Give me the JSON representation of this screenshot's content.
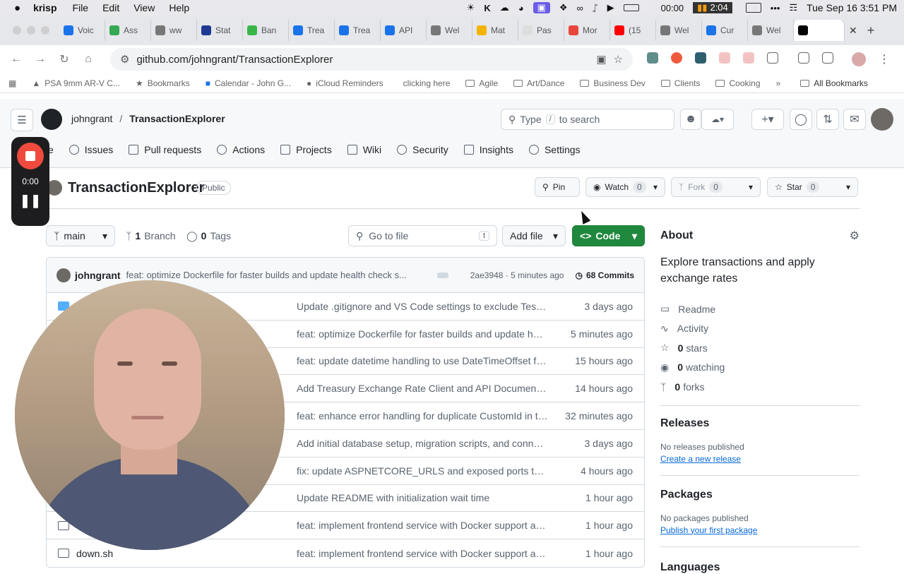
{
  "menubar": {
    "app": "krisp",
    "items": [
      "File",
      "Edit",
      "View",
      "Help"
    ],
    "timer": "00:00",
    "rec_badge": "2:04",
    "datetime": "Tue Sep 16  3:51 PM"
  },
  "tabs": [
    "Voic",
    "Ass",
    "ww",
    "Stat",
    "Ban",
    "Trea",
    "Trea",
    "API",
    "Wel",
    "Mat",
    "Pas",
    "Mor",
    "(15",
    "Wel",
    "Cur",
    "Wel",
    ""
  ],
  "tab_colors": [
    "#1a73e8",
    "#34a853",
    "#777777",
    "#1f3a93",
    "#3ab54a",
    "#1a73e8",
    "#1a73e8",
    "#1a73e8",
    "#777777",
    "#f4b400",
    "#dddddd",
    "#e8453c",
    "#ff0000",
    "#777777",
    "#1a73e8",
    "#777777",
    "#000000"
  ],
  "address": {
    "url": "github.com/johngrant/TransactionExplorer"
  },
  "bookmarks": [
    "PSA 9mm AR-V C...",
    "Bookmarks",
    "Calendar - John G...",
    "iCloud Reminders",
    "clicking here",
    "Agile",
    "Art/Dance",
    "Business Dev",
    "Clients",
    "Cooking",
    "All Bookmarks"
  ],
  "gh": {
    "owner": "johngrant",
    "sep": "/",
    "repo": "TransactionExplorer",
    "search_prefix": "Type",
    "search_key": "/",
    "search_suffix": "to search",
    "nav": [
      "e",
      "Issues",
      "Pull requests",
      "Actions",
      "Projects",
      "Wiki",
      "Security",
      "Insights",
      "Settings"
    ],
    "repo_title": "TransactionExplorer",
    "visibility": "Public",
    "pin": "Pin",
    "watch": "Watch",
    "watch_count": "0",
    "fork": "Fork",
    "fork_count": "0",
    "star": "Star",
    "star_count": "0",
    "branch": "main",
    "branches_num": "1",
    "branches_label": "Branch",
    "tags_num": "0",
    "tags_label": "Tags",
    "goto_placeholder": "Go to file",
    "goto_key": "t",
    "add_file": "Add file",
    "code": "Code"
  },
  "commit": {
    "author": "johngrant",
    "message": "feat: optimize Dockerfile for faster builds and update health check s...",
    "sha_time": "2ae3948 · 5 minutes ago",
    "count_label": "68 Commits"
  },
  "files": [
    {
      "name": "",
      "msg": "Update .gitignore and VS Code settings to exclude TestRe...",
      "time": "3 days ago"
    },
    {
      "name": "",
      "msg": "feat: optimize Dockerfile for faster builds and update heal...",
      "time": "5 minutes ago"
    },
    {
      "name": "",
      "msg": "feat: update datetime handling to use DateTimeOffset for ...",
      "time": "15 hours ago"
    },
    {
      "name": "",
      "msg": "Add Treasury Exchange Rate Client and API Documentation",
      "time": "14 hours ago"
    },
    {
      "name": "",
      "msg": "feat: enhance error handling for duplicate CustomId in tra...",
      "time": "32 minutes ago"
    },
    {
      "name": "",
      "msg": "Add initial database setup, migration scripts, and connect...",
      "time": "3 days ago"
    },
    {
      "name": "",
      "msg": "fix: update ASPNETCORE_URLS and exposed ports to us...",
      "time": "4 hours ago"
    },
    {
      "name": "",
      "msg": "Update README with initialization wait time",
      "time": "1 hour ago"
    },
    {
      "name": "",
      "msg": "feat: implement frontend service with Docker support and...",
      "time": "1 hour ago"
    },
    {
      "name": "down.sh",
      "msg": "feat: implement frontend service with Docker support and...",
      "time": "1 hour ago"
    }
  ],
  "about": {
    "title": "About",
    "description": "Explore transactions and apply exchange rates",
    "readme": "Readme",
    "activity": "Activity",
    "stars_num": "0",
    "stars": "stars",
    "watching_num": "0",
    "watching": "watching",
    "forks_num": "0",
    "forks": "forks",
    "releases_title": "Releases",
    "releases_none": "No releases published",
    "releases_link": "Create a new release",
    "packages_title": "Packages",
    "packages_none": "No packages published",
    "packages_link": "Publish your first package",
    "languages_title": "Languages"
  },
  "recorder": {
    "time": "0:00"
  },
  "colors": {
    "code_green": "#1f883d",
    "rec_red": "#ef4a3d",
    "link": "#0969da"
  }
}
